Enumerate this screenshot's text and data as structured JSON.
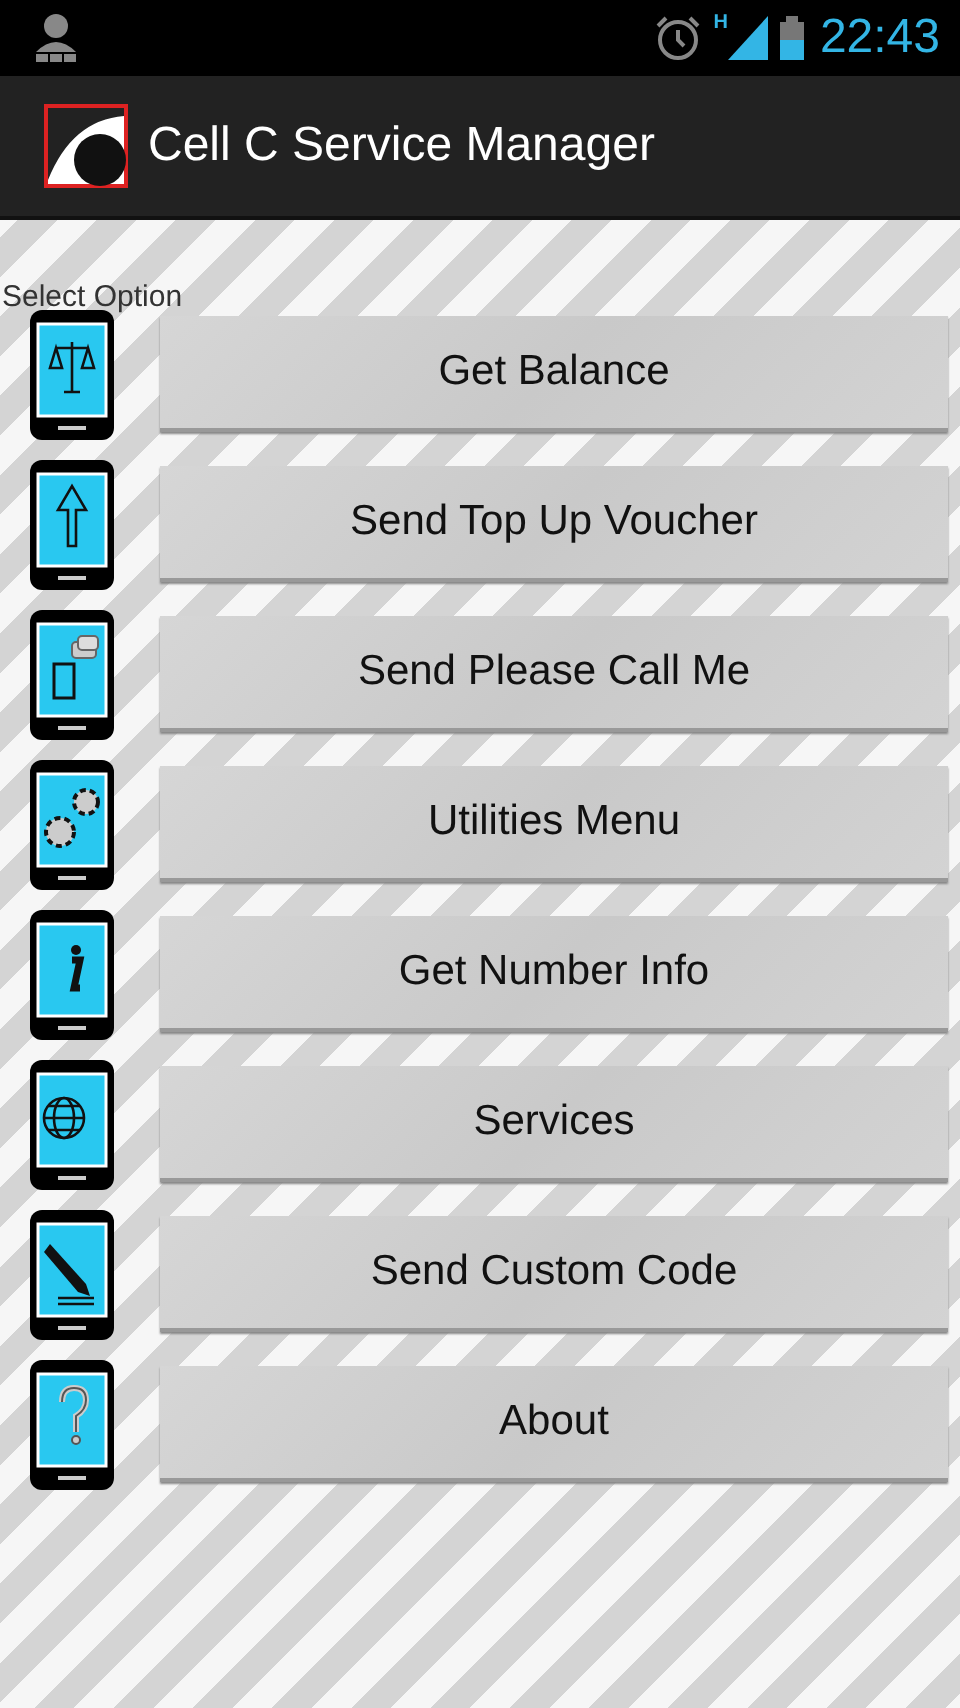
{
  "status_bar": {
    "time": "22:43",
    "network": "H"
  },
  "action_bar": {
    "title": "Cell C Service Manager"
  },
  "prompt": "Select Option",
  "options": [
    {
      "label": "Get Balance"
    },
    {
      "label": "Send Top Up Voucher"
    },
    {
      "label": "Send Please Call Me"
    },
    {
      "label": "Utilities Menu"
    },
    {
      "label": "Get Number Info"
    },
    {
      "label": "Services"
    },
    {
      "label": "Send Custom Code"
    },
    {
      "label": "About"
    }
  ]
}
